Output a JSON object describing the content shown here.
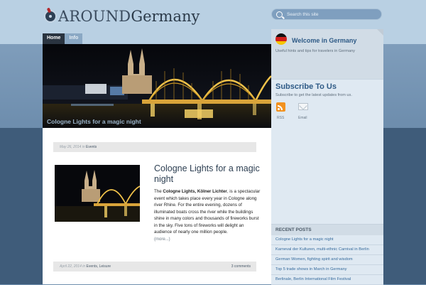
{
  "header": {
    "logo_part1": "AROUND",
    "logo_part2": "Germany",
    "search_placeholder": "Search this site"
  },
  "nav": {
    "items": [
      {
        "label": "Home"
      },
      {
        "label": "Info"
      }
    ]
  },
  "hero": {
    "caption": "Cologne Lights for a magic night"
  },
  "posts": [
    {
      "date": "May 26, 2014",
      "in_word": "in",
      "category": "Events",
      "title": "Cologne Lights for a magic night",
      "body_the": "The",
      "body_bold": "Cologne Lights, Kölner Lichter",
      "body_rest": ", is a spectacular event which takes place every year in Cologne along river Rhine. For the entire evening, dozens of illuminated boats cross the river while the buildings shine in many colors and thousands of fireworks burst in the sky. Five tons of fireworks will delight an audience of nearly one million people.",
      "more": "(more...)"
    },
    {
      "date": "April 22, 2014",
      "in_word": "in",
      "categories": "Events, Leisure",
      "comments": "3 comments"
    }
  ],
  "sidebar": {
    "welcome": {
      "title": "Welcome in Germany",
      "text": "Useful hints and tips for travelers in Germany"
    },
    "subscribe": {
      "title": "Subscribe To Us",
      "text": "Subscribe to get the latest updates from us.",
      "rss_label": "RSS",
      "email_label": "Email"
    },
    "recent": {
      "heading": "RECENT POSTS",
      "items": [
        "Cologne Lights for a magic night",
        "Karneval der Kulturen, multi-ethnic Carnival in Berlin",
        "German Women, fighting spirit and wisdom",
        "Top 5 trade shows in March in Germany",
        "Berlinale, Berlin International Film Festival"
      ]
    }
  },
  "colors": {
    "accent": "#2e5a86",
    "nav_active": "#2a3440",
    "rss": "#f2921f"
  }
}
